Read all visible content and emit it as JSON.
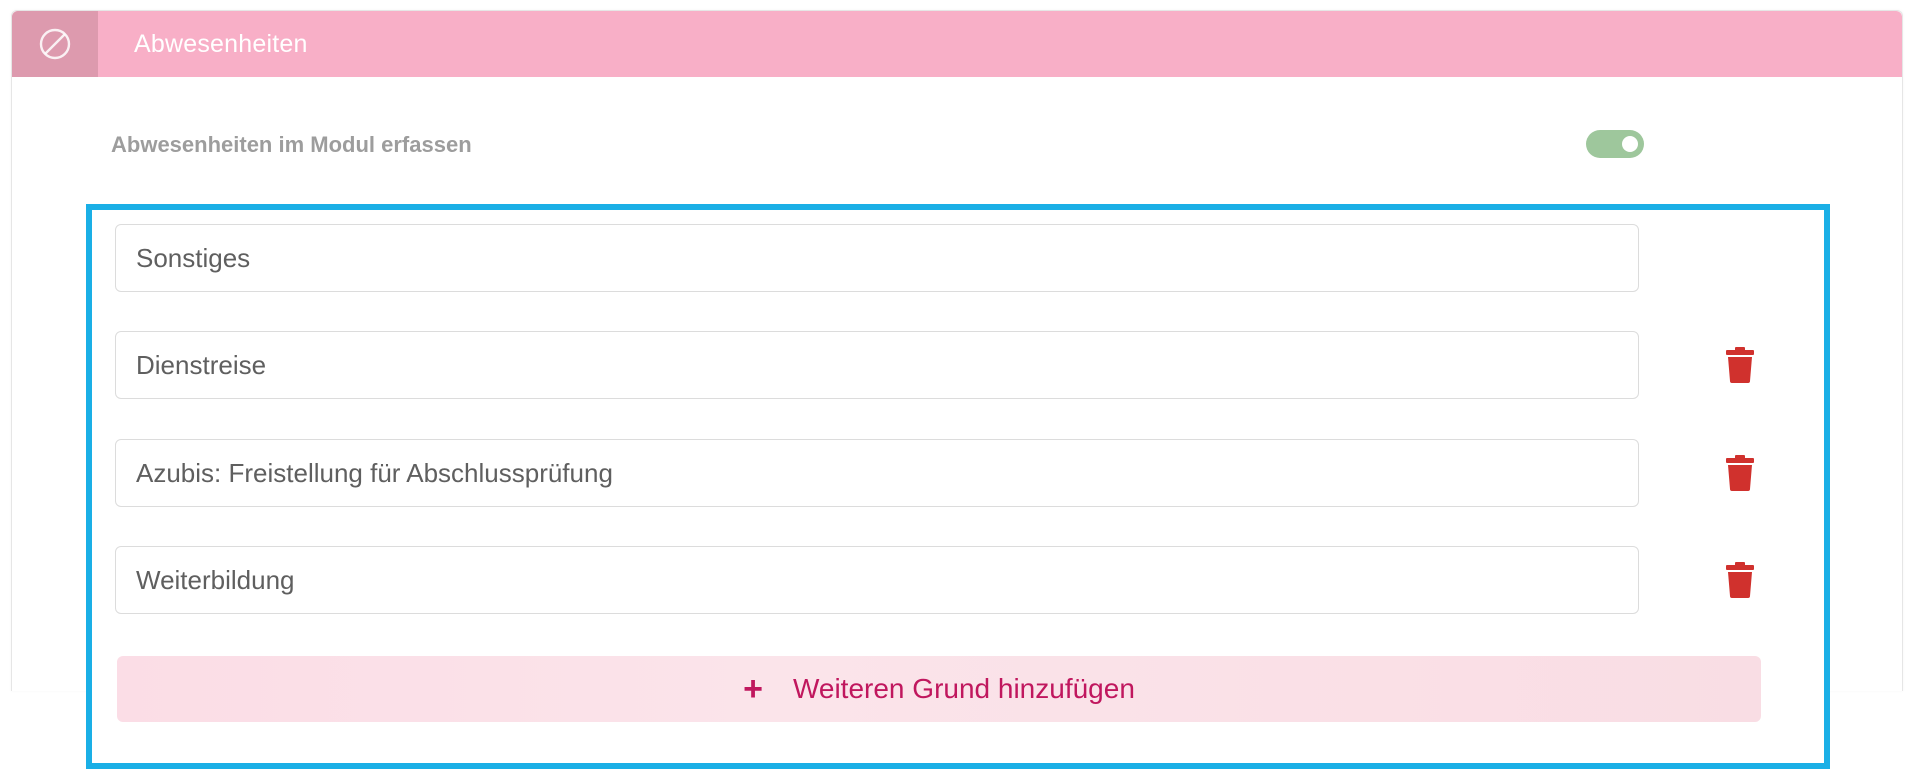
{
  "header": {
    "title": "Abwesenheiten",
    "icon": "ban-icon",
    "background_color": "#f8afc7",
    "icon_box_color": "#dd9aae"
  },
  "setting": {
    "label": "Abwesenheiten im Modul erfassen",
    "toggle_on": true,
    "toggle_color": "#9ec79c"
  },
  "reasons": [
    {
      "value": "Sonstiges",
      "deletable": false
    },
    {
      "value": "Dienstreise",
      "deletable": true
    },
    {
      "value": "Azubis: Freistellung für Abschlussprüfung",
      "deletable": true
    },
    {
      "value": "Weiterbildung",
      "deletable": true
    }
  ],
  "delete_icon": "trash-icon",
  "delete_color": "#d0312d",
  "add_button": {
    "plus": "+",
    "label": "Weiteren Grund hinzufügen",
    "text_color": "#c0175e"
  },
  "highlight_color": "#1aafe6"
}
